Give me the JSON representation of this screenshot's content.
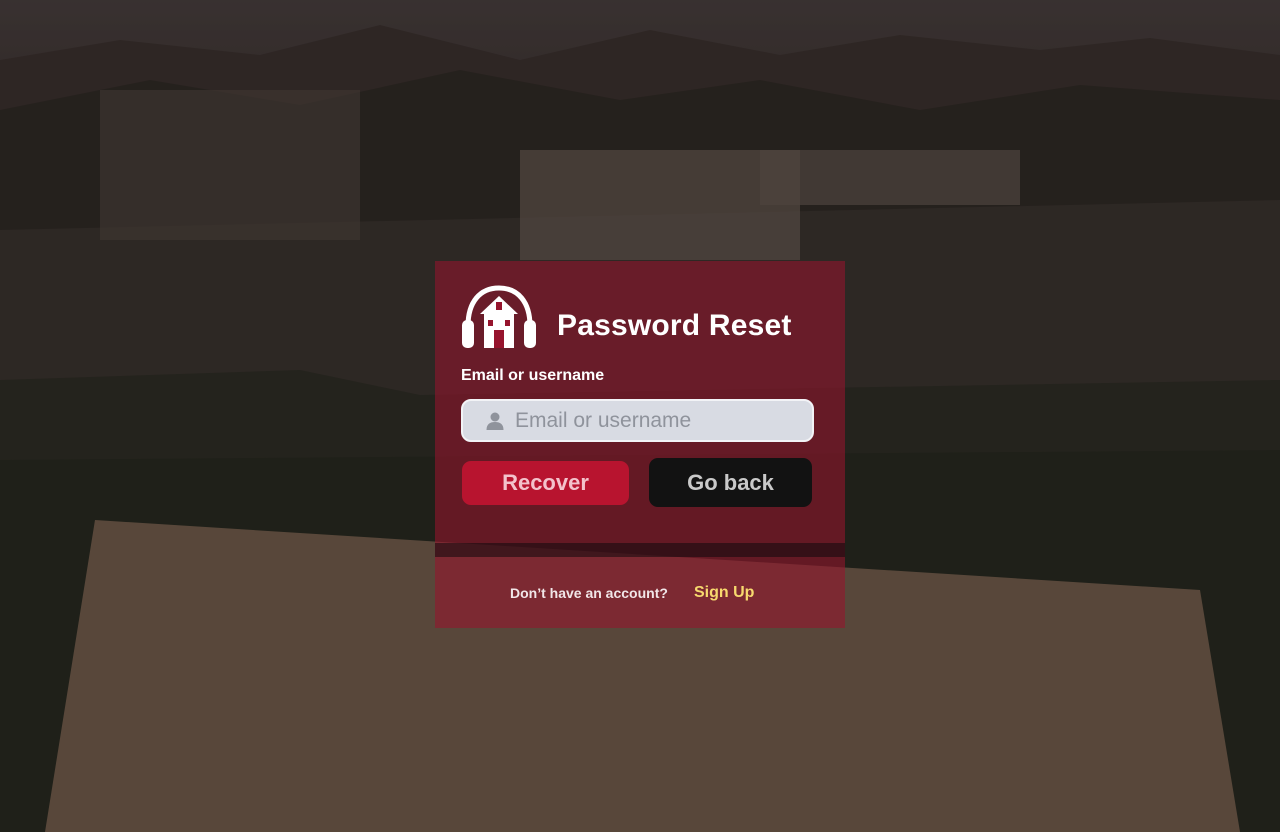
{
  "page": {
    "title": "Password Reset"
  },
  "form": {
    "field_label": "Email or username",
    "input_value": "",
    "input_placeholder": "Email or username",
    "input_icon": "user-icon"
  },
  "actions": {
    "recover_label": "Recover",
    "go_back_label": "Go back"
  },
  "footer": {
    "prompt": "Don’t have an account?",
    "signup_label": "Sign Up"
  },
  "brand": {
    "logo_icon": "headphones-building-logo-icon"
  },
  "colors": {
    "card_overlay": "#96142d",
    "recover_button": "#b8142f",
    "go_back_button": "#121212",
    "signup_link": "#f7d96e",
    "input_background": "#d8dbe3"
  }
}
